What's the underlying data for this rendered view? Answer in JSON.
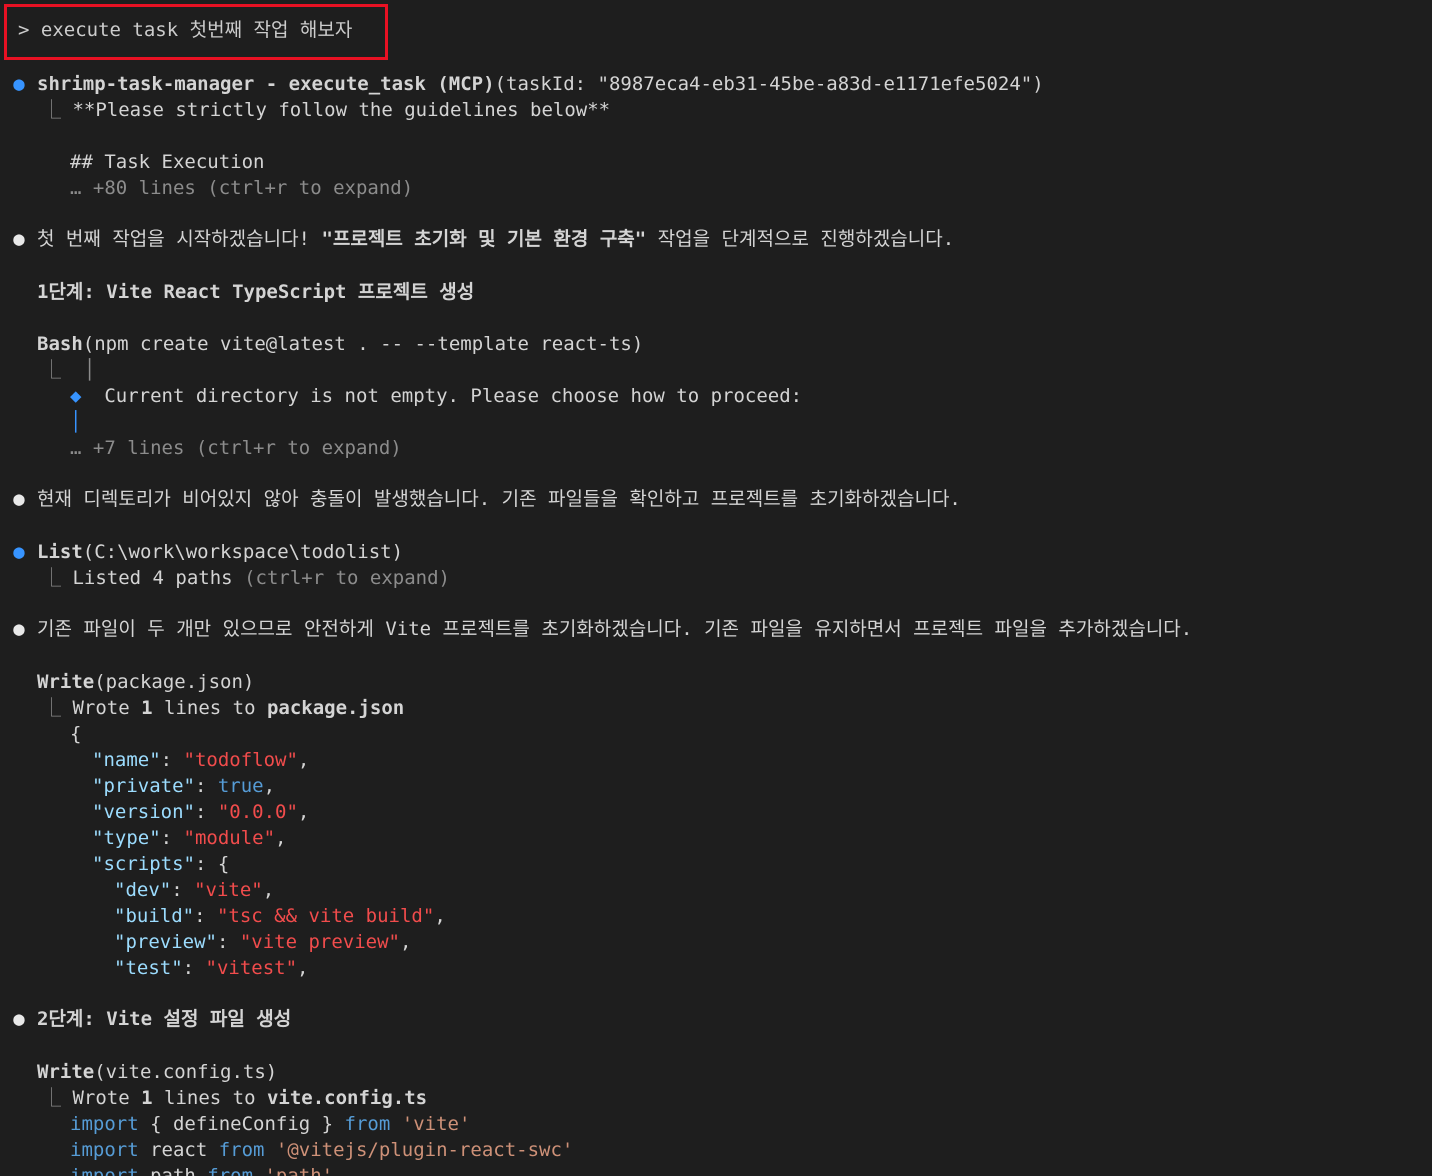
{
  "prompt": {
    "caret": ">",
    "command": "execute task 첫번째 작업 해보자"
  },
  "blocks": {
    "mcp": {
      "tool": "shrimp-task-manager - execute_task (MCP)",
      "args": "(taskId: \"8987eca4-eb31-45be-a83d-e1171efe5024\")",
      "line1": "**Please strictly follow the guidelines below**",
      "line2": "## Task Execution",
      "more": "… +80 lines (ctrl+r to expand)"
    },
    "msg1": {
      "pre": "첫 번째 작업을 시작하겠습니다! ",
      "bold": "\"프로젝트 초기화 및 기본 환경 구축\"",
      "post": " 작업을 단계적으로 진행하겠습니다."
    },
    "step1": "1단계: Vite React TypeScript 프로젝트 생성",
    "bash": {
      "tool": "Bash",
      "args": "(npm create vite@latest . -- --template react-ts)",
      "bar": "│",
      "diamond": "◆",
      "msg": "Current directory is not empty. Please choose how to proceed:",
      "more": "… +7 lines (ctrl+r to expand)"
    },
    "msg2": "현재 디렉토리가 비어있지 않아 충돌이 발생했습니다. 기존 파일들을 확인하고 프로젝트를 초기화하겠습니다.",
    "list": {
      "tool": "List",
      "args": "(C:\\work\\workspace\\todolist)",
      "result": "Listed 4 paths",
      "hint": " (ctrl+r to expand)"
    },
    "msg3": "기존 파일이 두 개만 있으므로 안전하게 Vite 프로젝트를 초기화하겠습니다. 기존 파일을 유지하면서 프로젝트 파일을 추가하겠습니다.",
    "write1": {
      "tool": "Write",
      "args": "(package.json)",
      "result_pre": "Wrote ",
      "result_n": "1",
      "result_mid": " lines to ",
      "result_file": "package.json"
    },
    "json": {
      "open": "{",
      "name_k": "\"name\"",
      "name_v": "\"todoflow\"",
      "private_k": "\"private\"",
      "private_v": "true",
      "version_k": "\"version\"",
      "version_v": "\"0.0.0\"",
      "type_k": "\"type\"",
      "type_v": "\"module\"",
      "scripts_k": "\"scripts\"",
      "scripts_open": "{",
      "dev_k": "\"dev\"",
      "dev_v": "\"vite\"",
      "build_k": "\"build\"",
      "build_v": "\"tsc && vite build\"",
      "preview_k": "\"preview\"",
      "preview_v": "\"vite preview\"",
      "test_k": "\"test\"",
      "test_v": "\"vitest\""
    },
    "step2": "2단계: Vite 설정 파일 생성",
    "write2": {
      "tool": "Write",
      "args": "(vite.config.ts)",
      "result_pre": "Wrote ",
      "result_n": "1",
      "result_mid": " lines to ",
      "result_file": "vite.config.ts"
    },
    "code": {
      "l1_kw": "import",
      "l1_mid": " { defineConfig } ",
      "l1_from": "from",
      "l1_str": " 'vite'",
      "l2_kw": "import",
      "l2_mid": " react ",
      "l2_from": "from",
      "l2_str": " '@vitejs/plugin-react-swc'",
      "l3_kw": "import",
      "l3_mid": " path ",
      "l3_from": "from",
      "l3_str": " 'path'"
    }
  },
  "glyphs": {
    "elbow": "⎿",
    "dot": "●"
  }
}
